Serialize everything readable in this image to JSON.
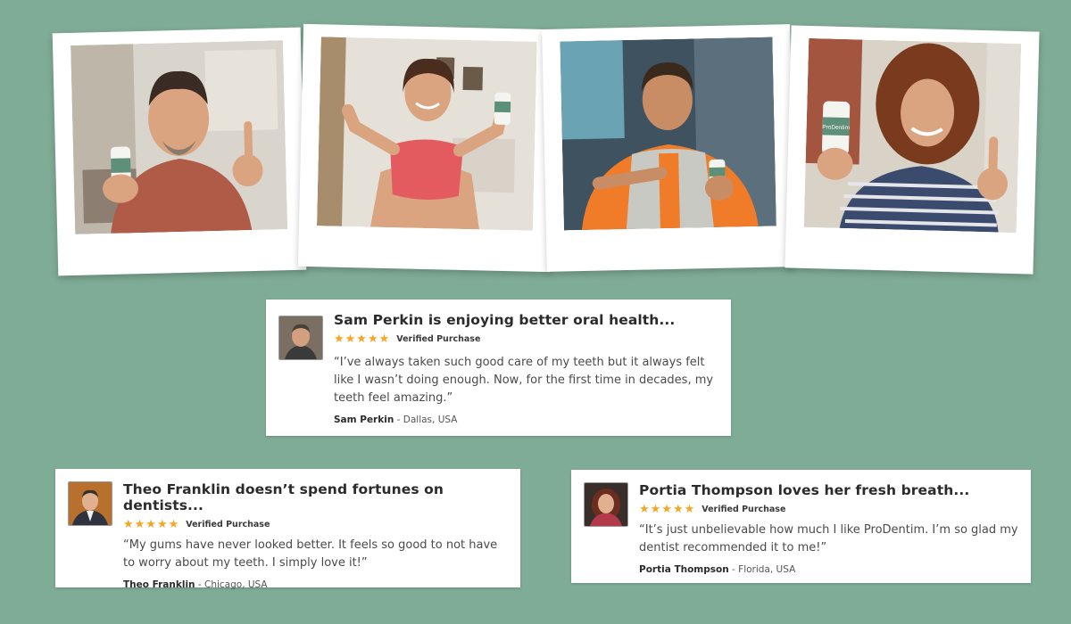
{
  "photos": [
    {
      "subject": "man-in-red-sweater-with-bottle"
    },
    {
      "subject": "woman-in-sports-top-thumbs-up-with-bottle"
    },
    {
      "subject": "man-in-vest-pointing-at-bottle"
    },
    {
      "subject": "woman-with-curly-hair-thumbs-up-with-bottle",
      "bottle_label": "ProDentim"
    }
  ],
  "reviews": [
    {
      "title": "Sam Perkin is enjoying better oral health...",
      "stars": "★★★★★",
      "verified": "Verified Purchase",
      "quote": "“I’ve always taken such good care of my teeth but it always felt like I wasn’t doing enough. Now, for the first time in decades, my teeth feel amazing.”",
      "name": "Sam Perkin",
      "location": " - Dallas, USA"
    },
    {
      "title": "Theo Franklin doesn’t spend fortunes on dentists...",
      "stars": "★★★★★",
      "verified": "Verified Purchase",
      "quote": "“My gums have never looked better. It feels so good to not have to worry about my teeth. I simply love it!”",
      "name": "Theo Franklin",
      "location": " - Chicago, USA"
    },
    {
      "title": "Portia Thompson loves her fresh breath...",
      "stars": "★★★★★",
      "verified": "Verified Purchase",
      "quote": "“It’s just unbelievable how much I like ProDentim. I’m so glad my dentist recommended it to me!”",
      "name": "Portia Thompson",
      "location": " - Florida, USA"
    }
  ],
  "colors": {
    "background": "#7fac97",
    "card": "#ffffff",
    "star": "#f5a623",
    "title": "#2b2b2b"
  }
}
